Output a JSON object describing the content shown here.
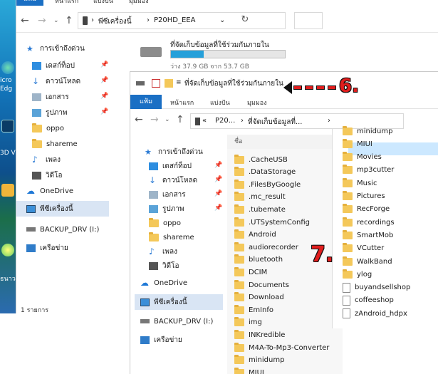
{
  "desktop": {
    "labels": [
      "icro",
      "Edg",
      "3D V",
      "ธนาว"
    ]
  },
  "back_window": {
    "ribbon": {
      "file": "แฟ้ม",
      "home": "หน้าแรก",
      "share": "แบ่งปัน",
      "view": "มุมมอง"
    },
    "address": {
      "segment1": "พีซีเครื่องนี้",
      "segment2": "P20HD_EEA"
    },
    "nav": [
      {
        "label": "การเข้าถึงด่วน",
        "pinned": false
      },
      {
        "label": "เดสก์ท็อป",
        "pinned": true
      },
      {
        "label": "ดาวน์โหลด",
        "pinned": true
      },
      {
        "label": "เอกสาร",
        "pinned": true
      },
      {
        "label": "รูปภาพ",
        "pinned": true
      },
      {
        "label": "oppo",
        "pinned": false
      },
      {
        "label": "shareme",
        "pinned": false
      },
      {
        "label": "เพลง",
        "pinned": false
      },
      {
        "label": "วิดีโอ",
        "pinned": false
      },
      {
        "label": "OneDrive",
        "pinned": false
      },
      {
        "label": "พีซีเครื่องนี้",
        "pinned": false
      },
      {
        "label": "BACKUP_DRV (I:)",
        "pinned": false
      },
      {
        "label": "เครือข่าย",
        "pinned": false
      }
    ],
    "drive": {
      "name": "ที่จัดเก็บข้อมูลที่ใช้ร่วมกันภายใน",
      "size_text": "ว่าง 37.9 GB จาก 53.7 GB",
      "used_fraction": 0.29
    },
    "status": "1 รายการ"
  },
  "front_window": {
    "title": "ที่จัดเก็บข้อมูลที่ใช้ร่วมกันภายใน",
    "ribbon": {
      "file": "แฟ้ม",
      "home": "หน้าแรก",
      "share": "แบ่งปัน",
      "view": "มุมมอง"
    },
    "address": {
      "prefix": "«",
      "segment1": "P20...",
      "segment2": "ที่จัดเก็บข้อมูลที่...",
      "more": "›"
    },
    "nav": [
      {
        "label": "การเข้าถึงด่วน",
        "pinned": false
      },
      {
        "label": "เดสก์ท็อป",
        "pinned": true
      },
      {
        "label": "ดาวน์โหลด",
        "pinned": true
      },
      {
        "label": "เอกสาร",
        "pinned": true
      },
      {
        "label": "รูปภาพ",
        "pinned": true
      },
      {
        "label": "oppo",
        "pinned": false
      },
      {
        "label": "shareme",
        "pinned": false
      },
      {
        "label": "เพลง",
        "pinned": false
      },
      {
        "label": "วิดีโอ",
        "pinned": false
      },
      {
        "label": "OneDrive",
        "pinned": false
      },
      {
        "label": "พีซีเครื่องนี้",
        "pinned": false
      },
      {
        "label": "BACKUP_DRV (I:)",
        "pinned": false
      },
      {
        "label": "เครือข่าย",
        "pinned": false
      }
    ],
    "column_header": "ชื่อ",
    "folders": [
      ".CacheUSB",
      ".DataStorage",
      ".FilesByGoogle",
      ".mc_result",
      ".tubemate",
      ".UTSystemConfig",
      "Android",
      "audiorecorder",
      "bluetooth",
      "DCIM",
      "Documents",
      "Download",
      "EmInfo",
      "img",
      "INKredible",
      "M4A-To-Mp3-Converter",
      "minidump",
      "MIUI"
    ]
  },
  "right_panel": {
    "items": [
      {
        "label": "minidump",
        "type": "folder"
      },
      {
        "label": "MIUI",
        "type": "folder"
      },
      {
        "label": "Movies",
        "type": "folder"
      },
      {
        "label": "mp3cutter",
        "type": "folder"
      },
      {
        "label": "Music",
        "type": "folder"
      },
      {
        "label": "Pictures",
        "type": "folder"
      },
      {
        "label": "RecForge",
        "type": "folder"
      },
      {
        "label": "recordings",
        "type": "folder"
      },
      {
        "label": "SmartMob",
        "type": "folder"
      },
      {
        "label": "VCutter",
        "type": "folder"
      },
      {
        "label": "WalkBand",
        "type": "folder"
      },
      {
        "label": "ylog",
        "type": "folder"
      },
      {
        "label": "buyandsellshop",
        "type": "file"
      },
      {
        "label": "coffeeshop",
        "type": "file"
      },
      {
        "label": "zAndroid_hdpx",
        "type": "file"
      }
    ]
  },
  "annotations": {
    "step6": "6.",
    "step7": "7."
  }
}
